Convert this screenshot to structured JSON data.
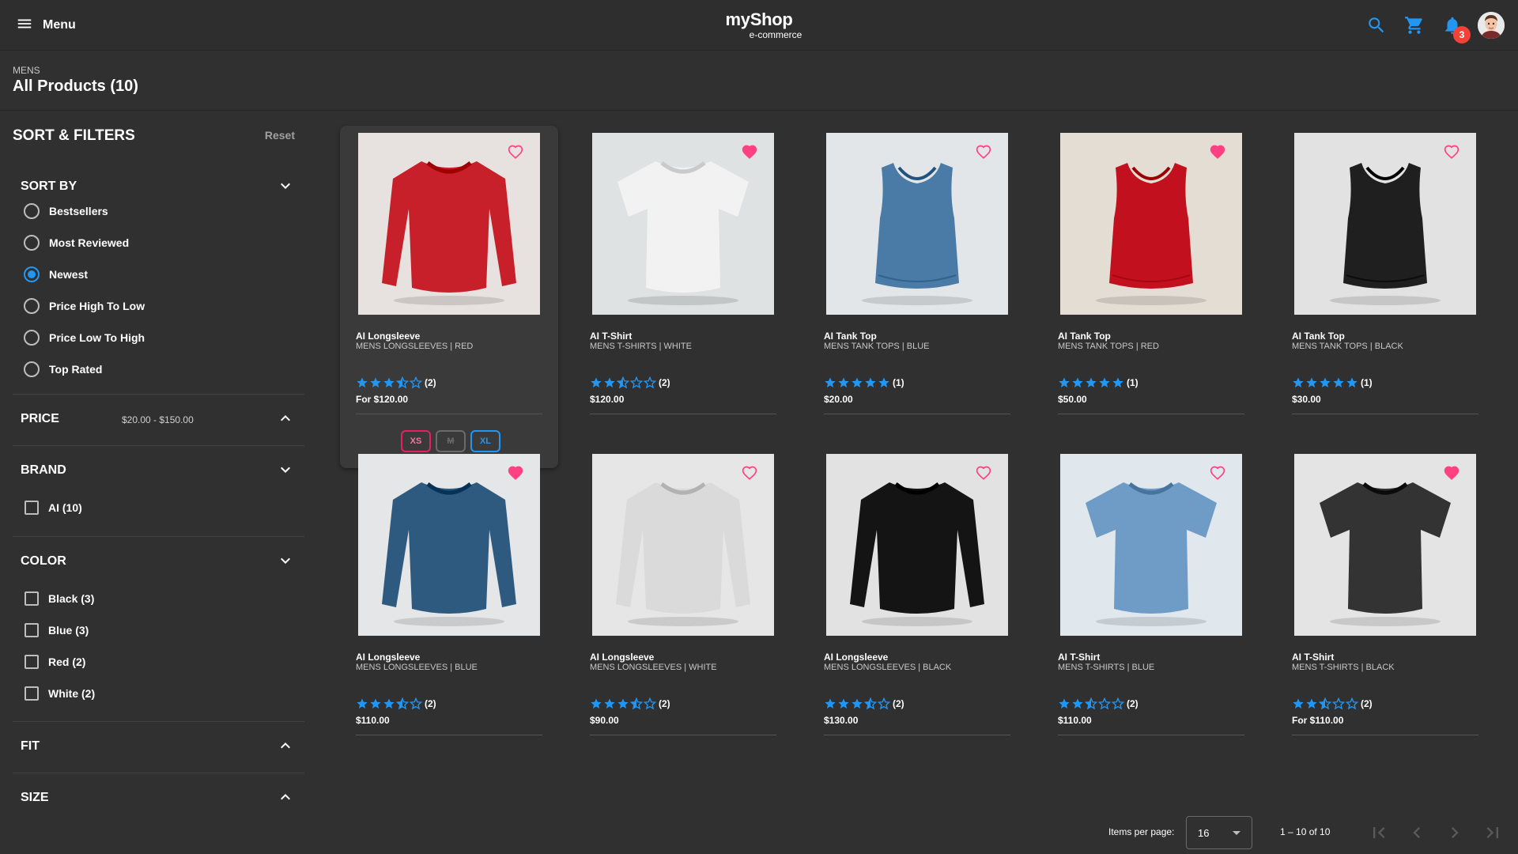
{
  "header": {
    "menu_label": "Menu",
    "brand_title": "myShop",
    "brand_subtitle": "e-commerce",
    "notification_count": "3",
    "accent_color": "#2196f3",
    "badge_color": "#f44336"
  },
  "breadcrumb": "MENS",
  "page_title": "All Products (10)",
  "filters": {
    "title": "SORT & FILTERS",
    "reset_label": "Reset",
    "sort": {
      "label": "SORT BY",
      "options": [
        "Bestsellers",
        "Most Reviewed",
        "Newest",
        "Price High To Low",
        "Price Low To High",
        "Top Rated"
      ],
      "selected": "Newest"
    },
    "price": {
      "label": "PRICE",
      "range": "$20.00 - $150.00"
    },
    "brand": {
      "label": "BRAND",
      "options": [
        "AI (10)"
      ]
    },
    "color": {
      "label": "COLOR",
      "options": [
        "Black (3)",
        "Blue (3)",
        "Red (2)",
        "White (2)"
      ]
    },
    "fit": {
      "label": "FIT"
    },
    "size": {
      "label": "SIZE"
    }
  },
  "products": [
    {
      "name": "AI Longsleeve",
      "subtitle": "MENS LONGSLEEVES | RED",
      "rating": 3.5,
      "reviews": "(2)",
      "price": "For $120.00",
      "favorite": false,
      "color": "#c8202a",
      "bg": "#e7e2df",
      "style": "longsleeve"
    },
    {
      "name": "AI T-Shirt",
      "subtitle": "MENS T-SHIRTS | WHITE",
      "rating": 2.5,
      "reviews": "(2)",
      "price": "$120.00",
      "favorite": true,
      "color": "#f2f2f2",
      "bg": "#dfe2e2",
      "style": "tshirt"
    },
    {
      "name": "AI Tank Top",
      "subtitle": "MENS TANK TOPS | BLUE",
      "rating": 5,
      "reviews": "(1)",
      "price": "$20.00",
      "favorite": false,
      "color": "#4a7aa6",
      "bg": "#e2e6e9",
      "style": "tank"
    },
    {
      "name": "AI Tank Top",
      "subtitle": "MENS TANK TOPS | RED",
      "rating": 5,
      "reviews": "(1)",
      "price": "$50.00",
      "favorite": true,
      "color": "#c3101f",
      "bg": "#e4ddd4",
      "style": "tank"
    },
    {
      "name": "AI Tank Top",
      "subtitle": "MENS TANK TOPS | BLACK",
      "rating": 5,
      "reviews": "(1)",
      "price": "$30.00",
      "favorite": false,
      "color": "#1f1f1f",
      "bg": "#e2e2e2",
      "style": "tank"
    },
    {
      "name": "AI Longsleeve",
      "subtitle": "MENS LONGSLEEVES | BLUE",
      "rating": 3.5,
      "reviews": "(2)",
      "price": "$110.00",
      "favorite": true,
      "color": "#2f5a80",
      "bg": "#e4e6e8",
      "style": "longsleeve"
    },
    {
      "name": "AI Longsleeve",
      "subtitle": "MENS LONGSLEEVES | WHITE",
      "rating": 3.5,
      "reviews": "(2)",
      "price": "$90.00",
      "favorite": false,
      "color": "#dadada",
      "bg": "#e6e6e6",
      "style": "longsleeve"
    },
    {
      "name": "AI Longsleeve",
      "subtitle": "MENS LONGSLEEVES | BLACK",
      "rating": 3.5,
      "reviews": "(2)",
      "price": "$130.00",
      "favorite": false,
      "color": "#141414",
      "bg": "#e2e2e2",
      "style": "longsleeve"
    },
    {
      "name": "AI T-Shirt",
      "subtitle": "MENS T-SHIRTS | BLUE",
      "rating": 2.5,
      "reviews": "(2)",
      "price": "$110.00",
      "favorite": false,
      "color": "#6f9cc6",
      "bg": "#e0e8ee",
      "style": "tshirt"
    },
    {
      "name": "AI T-Shirt",
      "subtitle": "MENS T-SHIRTS | BLACK",
      "rating": 2.5,
      "reviews": "(2)",
      "price": "For $110.00",
      "favorite": true,
      "color": "#333333",
      "bg": "#e4e4e4",
      "style": "tshirt"
    }
  ],
  "hovered_sizes": [
    "XS",
    "M",
    "XL"
  ],
  "pagination": {
    "items_label": "Items per page:",
    "page_size": "16",
    "range": "1 – 10 of 10"
  },
  "colors": {
    "background": "#303030",
    "star": "#2196f3",
    "heart": "#ff4081"
  }
}
